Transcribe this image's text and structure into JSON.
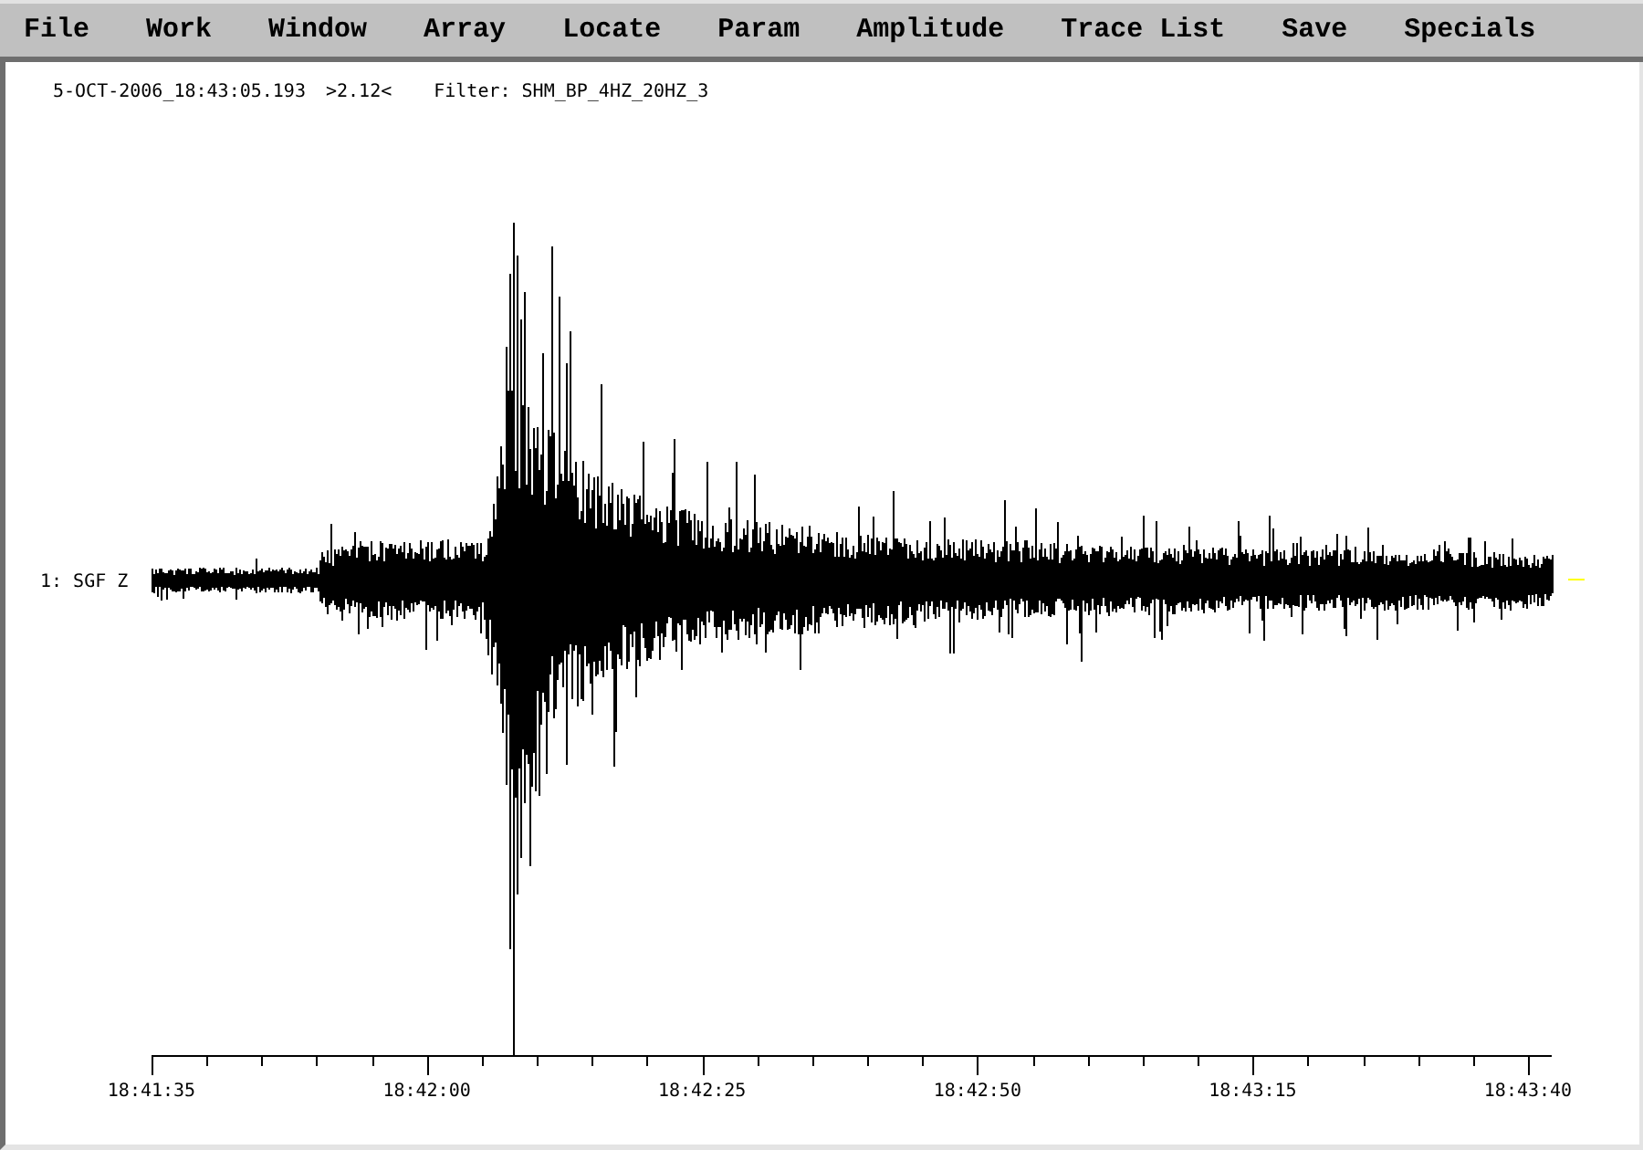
{
  "menu_bar": {
    "items": [
      "File",
      "Work",
      "Window",
      "Array",
      "Locate",
      "Param",
      "Amplitude",
      "Trace List",
      "Save",
      "Specials"
    ]
  },
  "header": {
    "timestamp": "5-OCT-2006_18:43:05.193",
    "scale": ">2.12<",
    "filter": "Filter: SHM_BP_4HZ_20HZ_3"
  },
  "traces": [
    {
      "label": "1: SGF Z"
    }
  ],
  "time_axis": {
    "labels": [
      "18:41:35",
      "18:42:00",
      "18:42:25",
      "18:42:50",
      "18:43:15",
      "18:43:40"
    ]
  }
}
